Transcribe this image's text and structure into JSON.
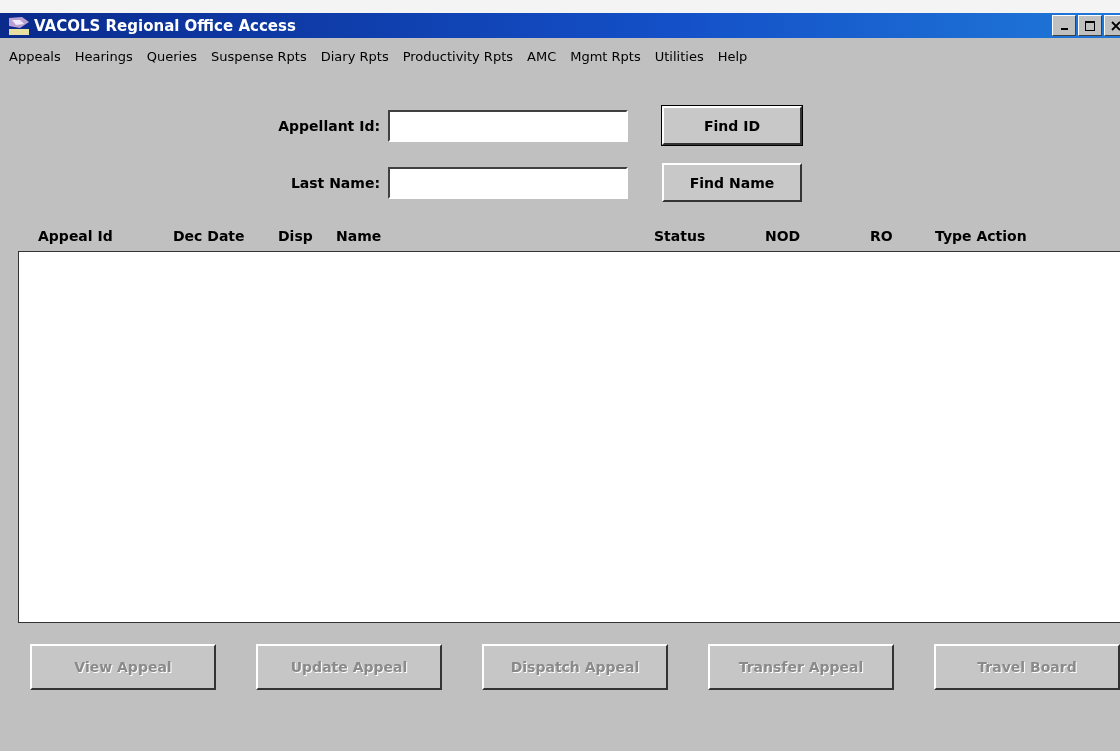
{
  "window": {
    "title": "VACOLS Regional Office Access"
  },
  "menu": [
    "Appeals",
    "Hearings",
    "Queries",
    "Suspense Rpts",
    "Diary Rpts",
    "Productivity Rpts",
    "AMC",
    "Mgmt Rpts",
    "Utilities",
    "Help"
  ],
  "search": [
    {
      "label": "Appellant Id:",
      "button": "Find ID",
      "default": true
    },
    {
      "label": "Last Name:",
      "button": "Find Name",
      "default": false
    }
  ],
  "table": {
    "columns": [
      "Appeal Id",
      "Dec Date",
      "Disp",
      "Name",
      "Status",
      "NOD",
      "RO",
      "Type Action"
    ]
  },
  "actions": [
    {
      "label": "View Appeal",
      "disabled": true
    },
    {
      "label": "Update Appeal",
      "disabled": true
    },
    {
      "label": "Dispatch Appeal",
      "disabled": true
    },
    {
      "label": "Transfer Appeal",
      "disabled": true
    },
    {
      "label": "Travel Board",
      "disabled": true
    }
  ]
}
